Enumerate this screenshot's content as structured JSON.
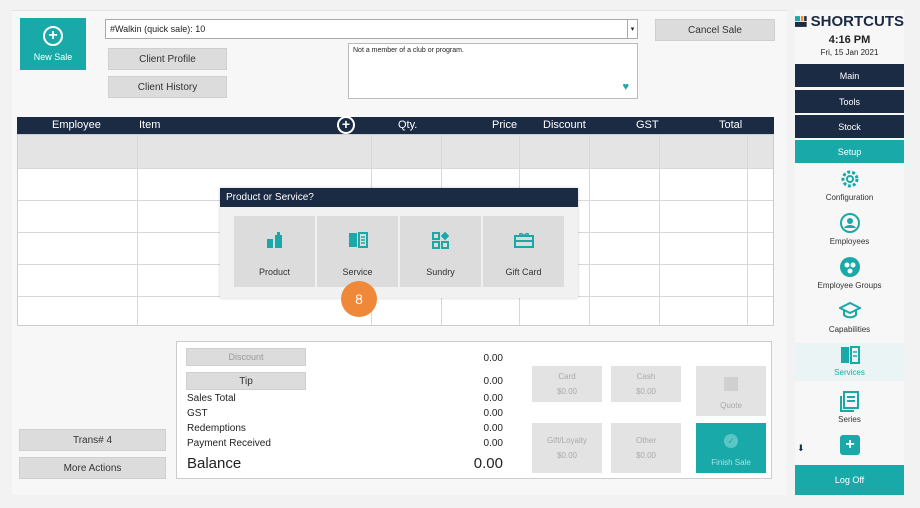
{
  "header": {
    "new_sale_label": "New Sale",
    "client_value": "#Walkin (quick sale): 10",
    "cancel_sale_label": "Cancel Sale",
    "client_profile_label": "Client Profile",
    "client_history_label": "Client History",
    "membership_note": "Not a member of a club or program."
  },
  "grid": {
    "columns": [
      "Employee",
      "Item",
      "Qty.",
      "Price",
      "Discount",
      "GST",
      "Total"
    ]
  },
  "modal": {
    "title": "Product or Service?",
    "options": [
      "Product",
      "Service",
      "Sundry",
      "Gift Card"
    ]
  },
  "step_badge": "8",
  "totals": {
    "discount_label": "Discount",
    "tip_label": "Tip",
    "discount_value": "0.00",
    "tip_value": "0.00",
    "rows": [
      {
        "label": "Sales Total",
        "value": "0.00"
      },
      {
        "label": "GST",
        "value": "0.00"
      },
      {
        "label": "Redemptions",
        "value": "0.00"
      },
      {
        "label": "Payment Received",
        "value": "0.00"
      }
    ],
    "balance_label": "Balance",
    "balance_value": "0.00"
  },
  "payments": {
    "card_label": "Card",
    "card_value": "$0.00",
    "cash_label": "Cash",
    "cash_value": "$0.00",
    "quote_label": "Quote",
    "gift_label": "Gift/Loyalty",
    "gift_value": "$0.00",
    "other_label": "Other",
    "other_value": "$0.00",
    "finish_label": "Finish Sale"
  },
  "left_buttons": {
    "trans_label": "Trans# 4",
    "more_actions_label": "More Actions"
  },
  "sidebar": {
    "brand": "SHORTCUTS",
    "time": "4:16 PM",
    "date": "Fri, 15 Jan 2021",
    "menu": [
      "Main",
      "Tools",
      "Stock",
      "Setup"
    ],
    "items": [
      "Configuration",
      "Employees",
      "Employee Groups",
      "Capabilities",
      "Services",
      "Series"
    ],
    "logoff_label": "Log Off"
  },
  "colors": {
    "teal": "#1aa9a9",
    "navy": "#1c2b44",
    "badge": "#f0883a"
  }
}
